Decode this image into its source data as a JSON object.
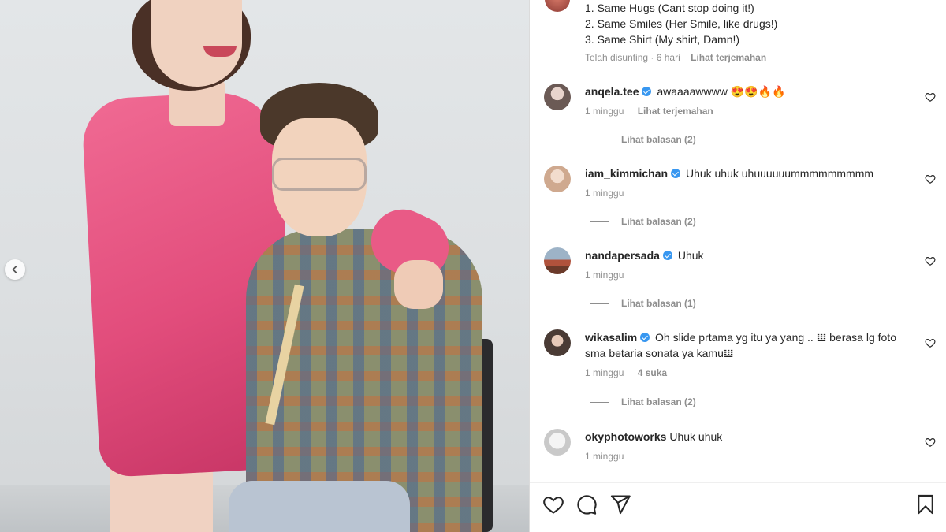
{
  "caption": {
    "lines": [
      "1. Same Hugs (Cant stop doing it!)",
      "2. Same Smiles (Her Smile, like drugs!)",
      "3. Same Shirt (My shirt, Damn!)"
    ],
    "edited": "Telah disunting",
    "sep": "·",
    "time": "6 hari",
    "translate": "Lihat terjemahan"
  },
  "comments": [
    {
      "user": "anqela.tee",
      "verified": true,
      "text": "awaaaawwww 😍😍🔥🔥",
      "time": "1 minggu",
      "extra": "Lihat terjemahan",
      "replies": "Lihat balasan (2)",
      "avatar_color": "#6b5a55"
    },
    {
      "user": "iam_kimmichan",
      "verified": true,
      "text": "Uhuk uhuk uhuuuuuummmmmmmmm",
      "time": "1 minggu",
      "extra": "",
      "replies": "Lihat balasan (2)",
      "avatar_color": "#d8b9a4"
    },
    {
      "user": "nandapersada",
      "verified": true,
      "text": "Uhuk",
      "time": "1 minggu",
      "extra": "",
      "replies": "Lihat balasan (1)",
      "avatar_color": "#b0523c"
    },
    {
      "user": "wikasalim",
      "verified": true,
      "text": "Oh slide prtama yg itu ya yang .. 𝍔 berasa lg foto sma betaria sonata ya kamu𝍔",
      "time": "1 minggu",
      "extra": "4 suka",
      "replies": "Lihat balasan (2)",
      "avatar_color": "#4a3b35"
    },
    {
      "user": "okyphotoworks",
      "verified": false,
      "text": "Uhuk uhuk",
      "time": "1 minggu",
      "extra": "",
      "replies": "",
      "avatar_color": "#c9c9c9"
    }
  ],
  "icons": {
    "carousel_prev": "chevron-left-icon",
    "like": "heart-icon",
    "comment": "comment-icon",
    "share": "send-icon",
    "save": "bookmark-icon"
  },
  "colors": {
    "verified": "#3897f0",
    "muted": "#8e8e8e",
    "text": "#262626"
  }
}
